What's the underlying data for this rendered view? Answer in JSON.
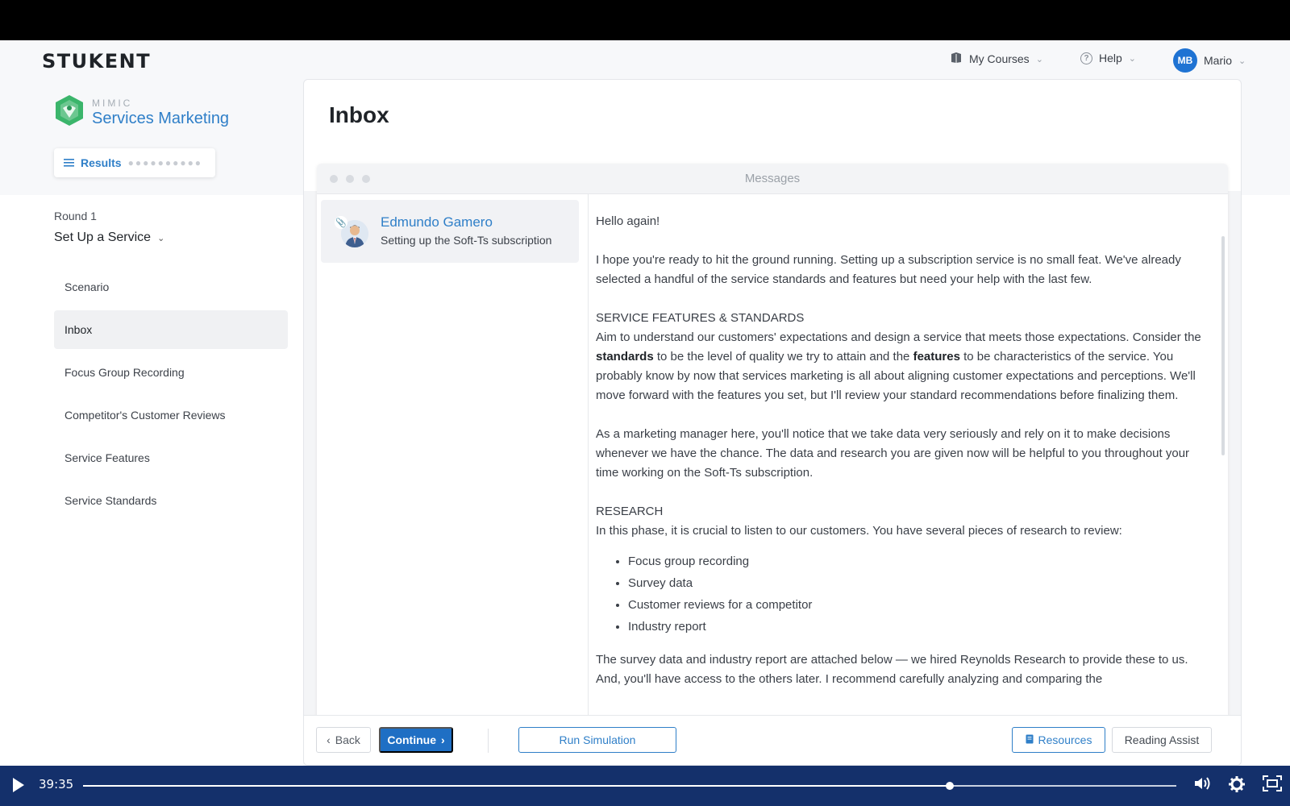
{
  "header": {
    "logo": "STUKENT",
    "my_courses": "My Courses",
    "help": "Help",
    "user_initials": "MB",
    "user_name": "Mario"
  },
  "brand": {
    "sub": "MIMIC",
    "title": "Services Marketing"
  },
  "results_button": "Results",
  "round": {
    "label": "Round 1",
    "title": "Set Up a Service"
  },
  "sidebar": {
    "items": [
      {
        "label": "Scenario"
      },
      {
        "label": "Inbox"
      },
      {
        "label": "Focus Group Recording"
      },
      {
        "label": "Competitor's Customer Reviews"
      },
      {
        "label": "Service Features"
      },
      {
        "label": "Service Standards"
      }
    ],
    "active": "Inbox"
  },
  "page": {
    "title": "Inbox"
  },
  "messages": {
    "window_title": "Messages",
    "list": [
      {
        "sender": "Edmundo Gamero",
        "subject": "Setting up the Soft-Ts subscription"
      }
    ],
    "body": {
      "greeting": "Hello again!",
      "p1": "I hope you're ready to hit the ground running. Setting up a subscription service is no small feat. We've already selected a handful of the service standards and features but need your help with the last few.",
      "h_features": "SERVICE FEATURES & STANDARDS",
      "p2_a": "Aim to understand our customers' expectations and design a service that meets those expectations. Consider the ",
      "p2_b1": "standards",
      "p2_c": " to be the level of quality we try to attain and the ",
      "p2_b2": "features",
      "p2_d": " to be characteristics of the service. You probably know by now that services marketing is all about aligning customer expectations and perceptions. We'll move forward with the features you set, but I'll review your standard recommendations before finalizing them.",
      "p3": "As a marketing manager here, you'll notice that we take data very seriously and rely on it to make decisions whenever we have the chance. The data and research you are given now will be helpful to you throughout your time working on the Soft-Ts subscription.",
      "h_research": "RESEARCH",
      "p4": "In this phase, it is crucial to listen to our customers. You have several pieces of research to review:",
      "bullets": [
        "Focus group recording",
        "Survey data",
        "Customer reviews for a competitor",
        "Industry report"
      ],
      "p5": "The survey data and industry report are attached below — we hired Reynolds Research to provide these to us. And, you'll have access to the others later. I recommend carefully analyzing and comparing the"
    }
  },
  "footer": {
    "back": "Back",
    "continue": "Continue",
    "run_simulation": "Run Simulation",
    "resources": "Resources",
    "reading_assist": "Reading Assist"
  },
  "video": {
    "time": "39:35",
    "progress": 0.793
  }
}
